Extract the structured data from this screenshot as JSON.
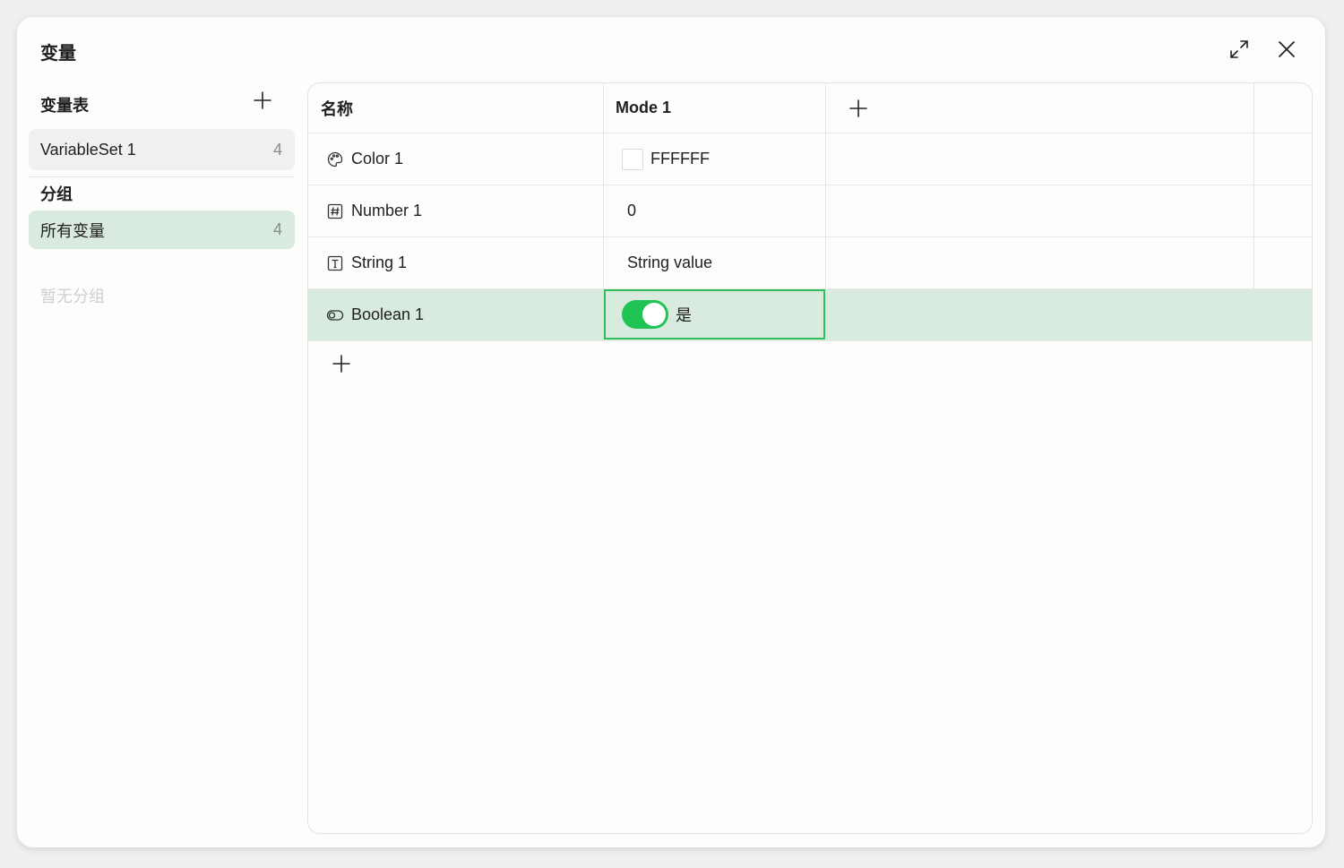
{
  "dialog": {
    "title": "变量"
  },
  "sidebar": {
    "sets_heading": "变量表",
    "sets": [
      {
        "label": "VariableSet 1",
        "count": "4"
      }
    ],
    "groups_heading": "分组",
    "groups": [
      {
        "label": "所有变量",
        "count": "4"
      }
    ],
    "no_groups_text": "暂无分组"
  },
  "table": {
    "columns": {
      "name": "名称",
      "mode": "Mode 1"
    },
    "rows": [
      {
        "name": "Color 1",
        "type_icon": "palette-icon",
        "value": "FFFFFF",
        "swatch_color": "#FFFFFF"
      },
      {
        "name": "Number 1",
        "type_icon": "number-icon",
        "value": "0"
      },
      {
        "name": "String 1",
        "type_icon": "text-icon",
        "value": "String value"
      },
      {
        "name": "Boolean 1",
        "type_icon": "toggle-icon",
        "value": "是",
        "toggle_on": true
      }
    ]
  },
  "colors": {
    "accent": "#21C454",
    "selection_bg": "#D9EADE"
  }
}
